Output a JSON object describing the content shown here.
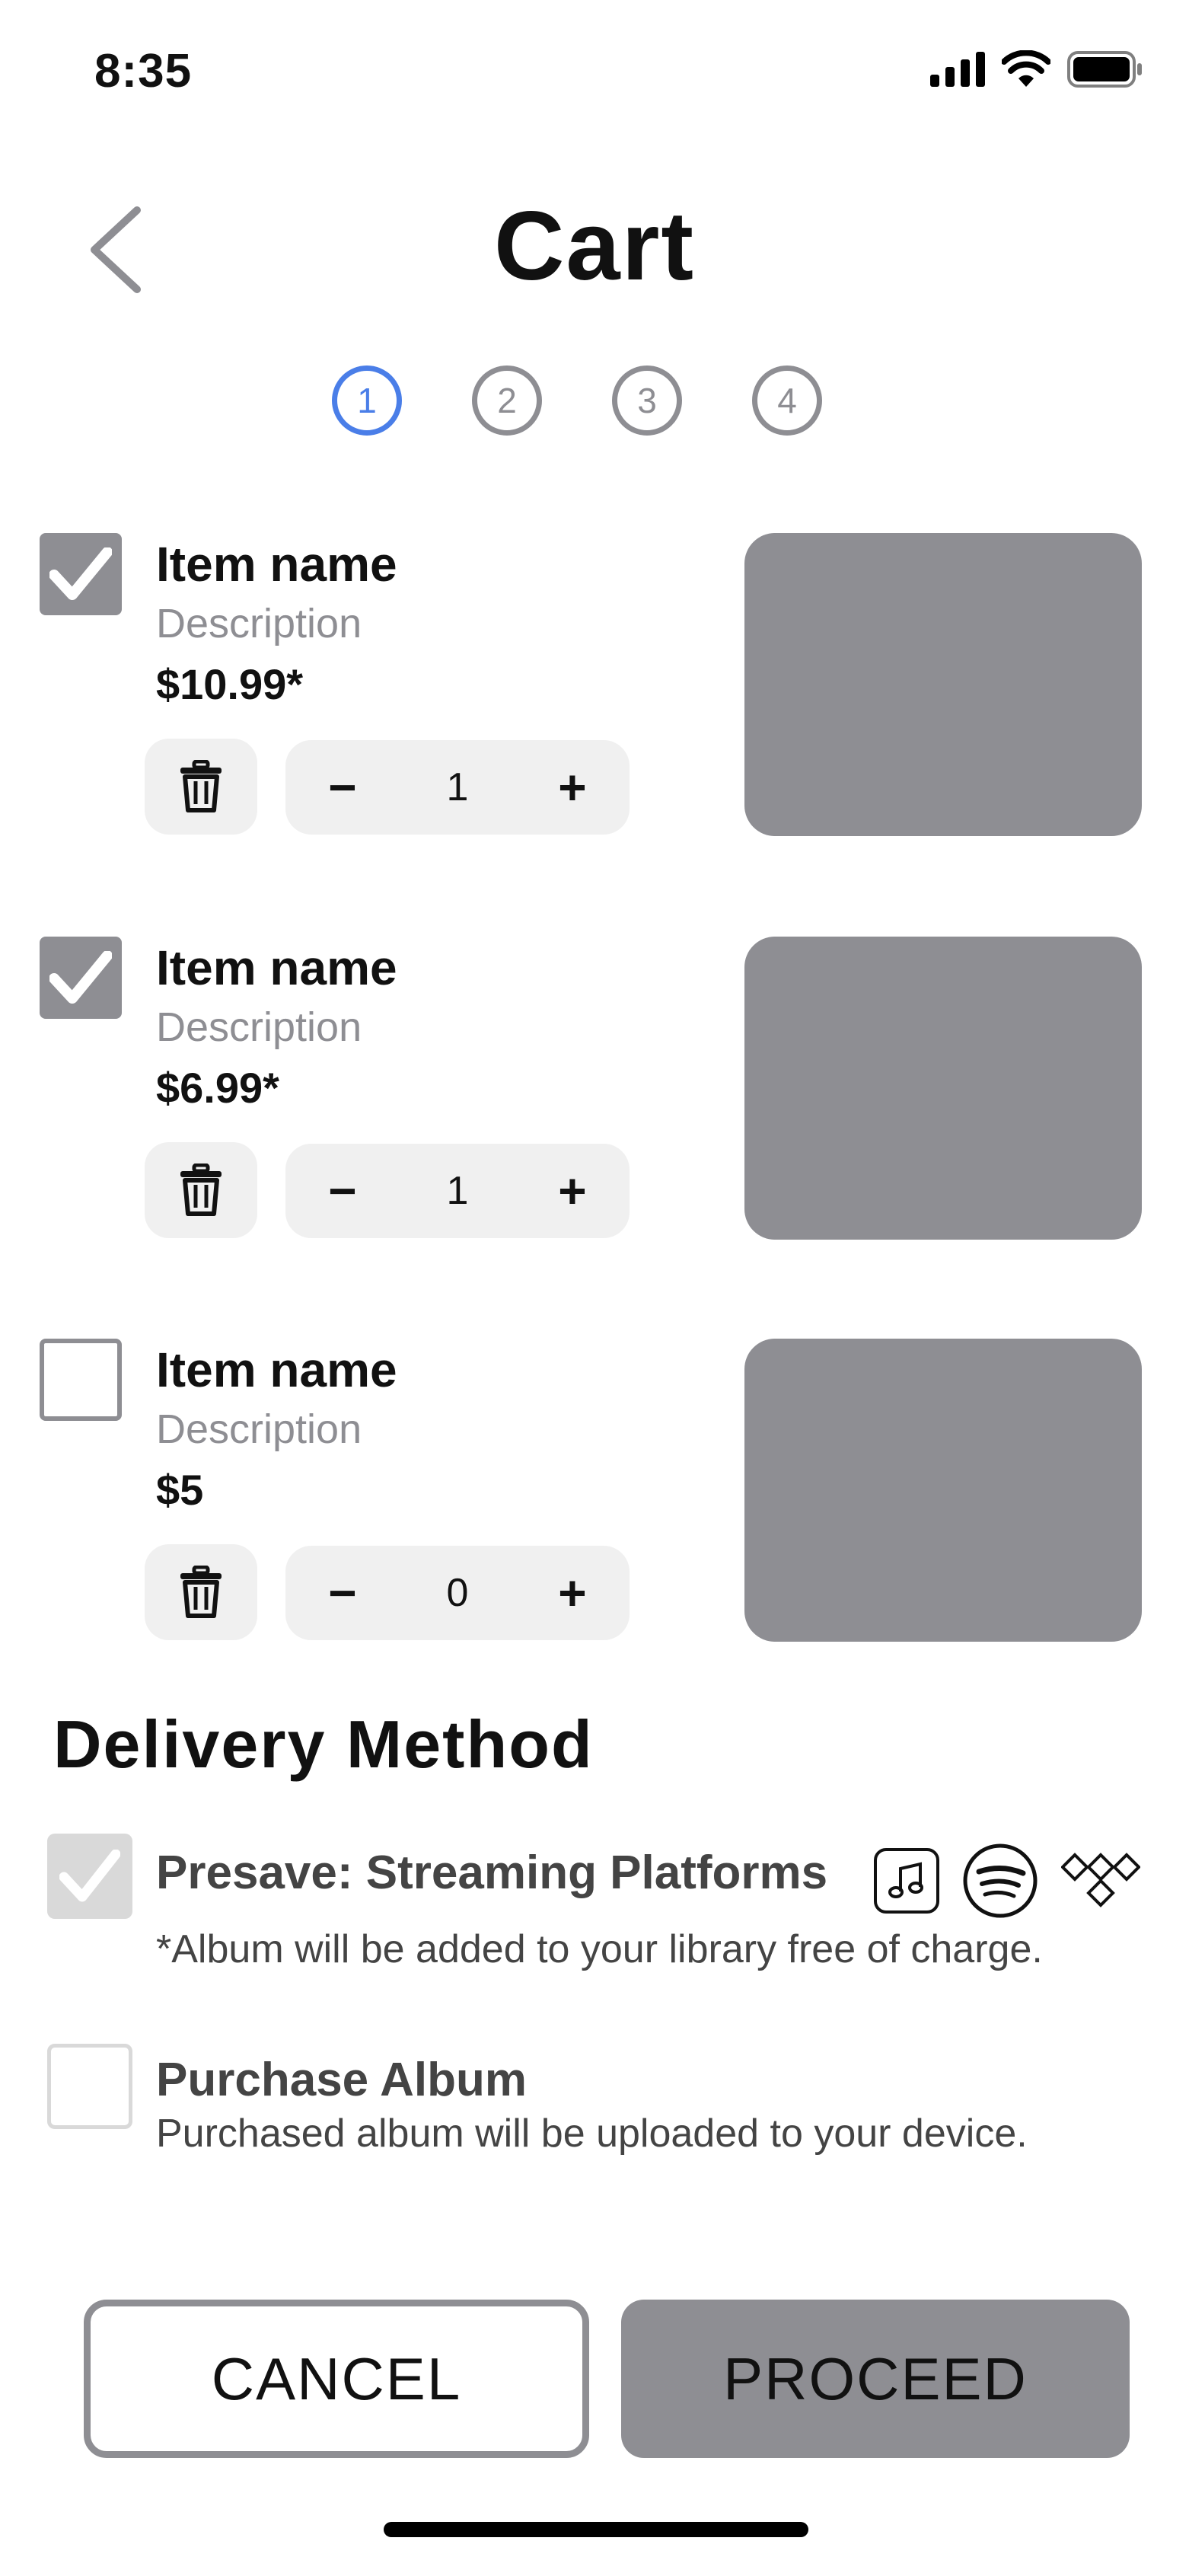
{
  "status_bar": {
    "time": "8:35"
  },
  "header": {
    "title": "Cart"
  },
  "steps": [
    "1",
    "2",
    "3",
    "4"
  ],
  "cart_items": [
    {
      "name": "Item name",
      "description": "Description",
      "price": "$10.99*",
      "quantity": "1",
      "checked": true
    },
    {
      "name": "Item name",
      "description": "Description",
      "price": "$6.99*",
      "quantity": "1",
      "checked": true
    },
    {
      "name": "Item name",
      "description": "Description",
      "price": "$5",
      "quantity": "0",
      "checked": false
    }
  ],
  "stepper": {
    "minus": "−",
    "plus": "+"
  },
  "delivery": {
    "title": "Delivery Method",
    "presave": {
      "title": "Presave: Streaming Platforms",
      "note": "*Album will be added to your library free of charge.",
      "checked": true
    },
    "purchase": {
      "title": "Purchase Album",
      "note": "Purchased album will be uploaded to your device.",
      "checked": false
    },
    "platform_icons": [
      "music-note-icon",
      "spotify-icon",
      "tidal-icon"
    ]
  },
  "buttons": {
    "cancel": "CANCEL",
    "proceed": "PROCEED"
  },
  "colors": {
    "accent": "#4a7ee8",
    "gray": "#8e8e93",
    "light_gray": "#f0f0f0"
  }
}
